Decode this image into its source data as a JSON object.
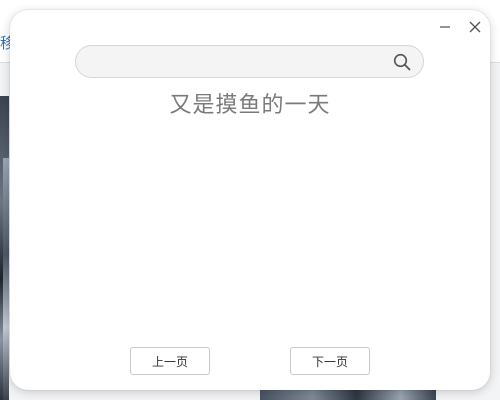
{
  "background_app": {
    "topbar_text": "移"
  },
  "dialog": {
    "window_controls": {
      "minimize_icon": "minimize-icon",
      "close_icon": "close-icon"
    },
    "search": {
      "value": "",
      "placeholder": "",
      "icon": "search-icon"
    },
    "headline": "又是摸鱼的一天",
    "pagination": {
      "prev_label": "上一页",
      "next_label": "下一页"
    }
  },
  "colors": {
    "headline": "#7a7a7a",
    "search_background": "#f4f4f4",
    "background_link": "#2f6fb2"
  }
}
